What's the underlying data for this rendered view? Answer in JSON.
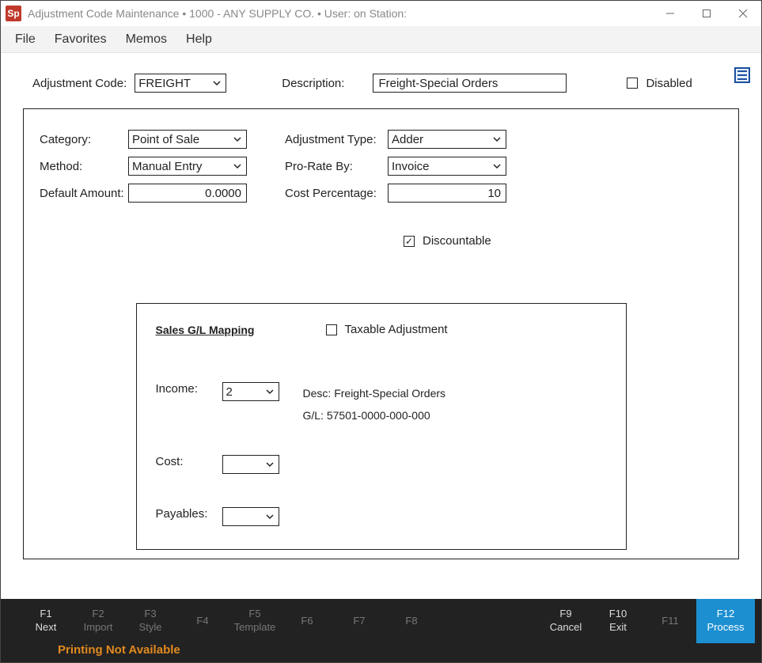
{
  "window": {
    "app_icon_text": "Sp",
    "title": "Adjustment Code Maintenance   •   1000 - ANY SUPPLY CO.   •   User:      on Station:"
  },
  "menu": {
    "file": "File",
    "favorites": "Favorites",
    "memos": "Memos",
    "help": "Help"
  },
  "top": {
    "adj_code_label": "Adjustment Code:",
    "adj_code_value": "FREIGHT",
    "description_label": "Description:",
    "description_value": "Freight-Special Orders",
    "disabled_label": "Disabled"
  },
  "form": {
    "category_label": "Category:",
    "category_value": "Point of Sale",
    "method_label": "Method:",
    "method_value": "Manual Entry",
    "default_amount_label": "Default Amount:",
    "default_amount_value": "0.0000",
    "adjustment_type_label": "Adjustment Type:",
    "adjustment_type_value": "Adder",
    "pro_rate_label": "Pro-Rate By:",
    "pro_rate_value": "Invoice",
    "cost_pct_label": "Cost Percentage:",
    "cost_pct_value": "10",
    "discountable_label": "Discountable"
  },
  "gl": {
    "heading": "Sales G/L Mapping",
    "taxable_label": "Taxable Adjustment",
    "income_label": "Income:",
    "income_value": "2",
    "desc_prefix": "Desc: ",
    "desc_value": "Freight-Special Orders",
    "gl_prefix": "G/L: ",
    "gl_value": "57501-0000-000-000",
    "cost_label": "Cost:",
    "cost_value": "",
    "payables_label": "Payables:",
    "payables_value": ""
  },
  "footer": {
    "keys": [
      {
        "num": "F1",
        "action": "Next",
        "dim": false
      },
      {
        "num": "F2",
        "action": "Import",
        "dim": true
      },
      {
        "num": "F3",
        "action": "Style",
        "dim": true
      },
      {
        "num": "F4",
        "action": "",
        "dim": true
      },
      {
        "num": "F5",
        "action": "Template",
        "dim": true
      },
      {
        "num": "F6",
        "action": "",
        "dim": true
      },
      {
        "num": "F7",
        "action": "",
        "dim": true
      },
      {
        "num": "F8",
        "action": "",
        "dim": true
      },
      {
        "num": "F9",
        "action": "Cancel",
        "dim": false
      },
      {
        "num": "F10",
        "action": "Exit",
        "dim": false
      },
      {
        "num": "F11",
        "action": "",
        "dim": true
      },
      {
        "num": "F12",
        "action": "Process",
        "dim": false,
        "process": true
      }
    ],
    "status": "Printing Not Available"
  }
}
